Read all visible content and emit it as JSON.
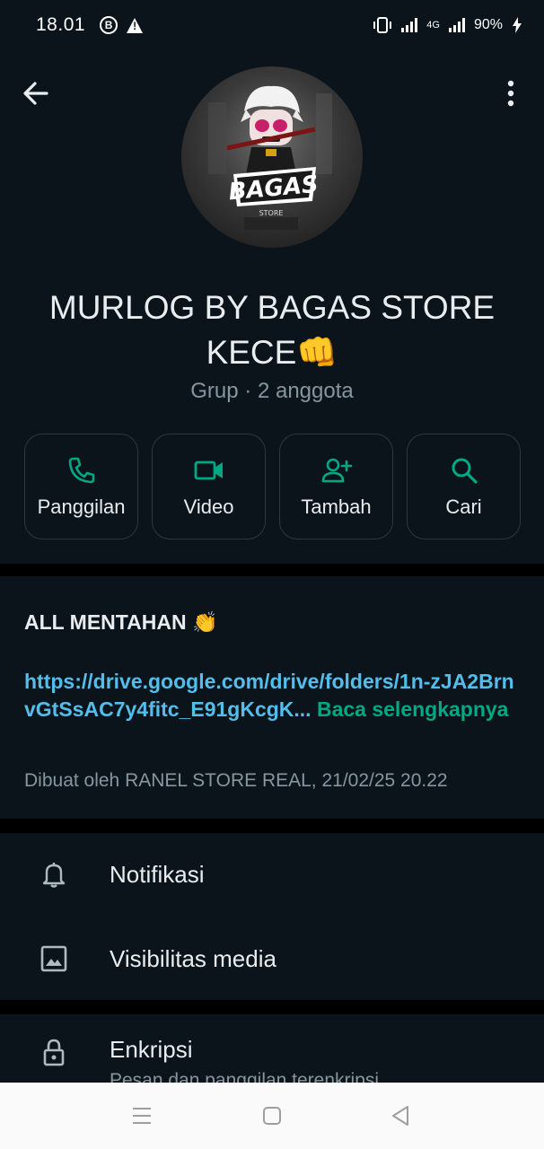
{
  "status_bar": {
    "time": "18.01",
    "network": "4G",
    "battery": "90%"
  },
  "header": {
    "group_name": "MURLOG BY BAGAS STORE KECE👊",
    "group_meta": "Grup · 2 anggota",
    "avatar_text": "BAGAS",
    "avatar_subtext": "STORE"
  },
  "actions": [
    {
      "label": "Panggilan",
      "icon": "phone-icon"
    },
    {
      "label": "Video",
      "icon": "video-icon"
    },
    {
      "label": "Tambah",
      "icon": "add-person-icon"
    },
    {
      "label": "Cari",
      "icon": "search-icon"
    }
  ],
  "description": {
    "title": "ALL MENTAHAN 👏",
    "link": "https://drive.google.com/drive/folders/1n-zJA2BrnvGtSsAC7y4fitc_E91gKcgK...",
    "read_more": "Baca selengkapnya",
    "created_by": "Dibuat oleh RANEL STORE REAL, 21/02/25 20.22"
  },
  "settings": {
    "notifications": "Notifikasi",
    "media_visibility": "Visibilitas media"
  },
  "encryption": {
    "title": "Enkripsi",
    "subtitle": "Pesan dan panggilan terenkripsi..."
  },
  "colors": {
    "background": "#0b141a",
    "accent_green": "#00a884",
    "link_blue": "#53bdeb",
    "secondary_text": "#8696a0"
  }
}
